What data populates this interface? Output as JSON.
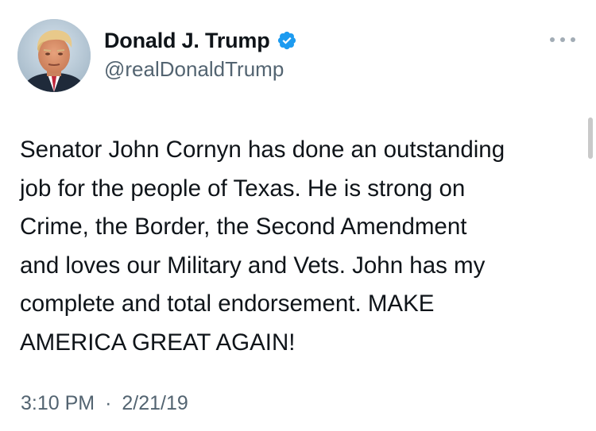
{
  "tweet": {
    "author": {
      "display_name": "Donald J. Trump",
      "handle": "@realDonaldTrump",
      "verified": true,
      "avatar_icon": "profile-photo"
    },
    "text": "Senator John Cornyn has done an outstanding\njob for the people of Texas. He is strong on\nCrime, the Border, the Second Amendment\nand loves our Military and Vets. John has my\ncomplete and total endorsement. MAKE\nAMERICA GREAT AGAIN!",
    "time": "3:10 PM",
    "separator": "·",
    "date": "2/21/19",
    "more_icon": "more-options-icon"
  },
  "colors": {
    "text_primary": "#0f1419",
    "text_secondary": "#536471",
    "verified_blue": "#1d9bf0",
    "more_dots": "#a2acb5",
    "background": "#ffffff"
  }
}
